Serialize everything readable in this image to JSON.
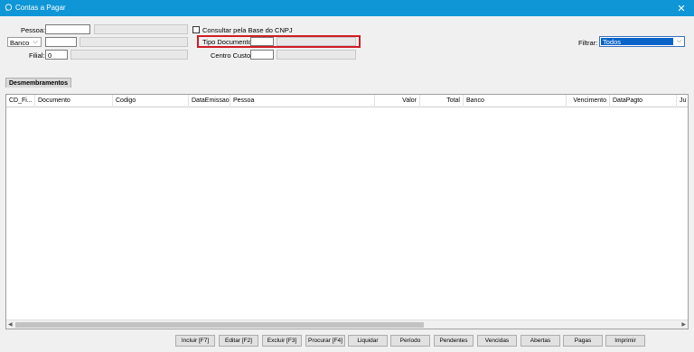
{
  "window": {
    "title": "Contas a Pagar",
    "close_glyph": "✕",
    "icon": "chat-bubble-icon"
  },
  "form": {
    "pessoa_label": "Pessoa:",
    "pessoa_value": "",
    "pessoa_name": "",
    "banco_select": "Banco",
    "banco_value": "",
    "banco_name": "",
    "filial_label": "Filial:",
    "filial_value": "0",
    "filial_name": "",
    "cnpj_checkbox_label": "Consultar pela Base do CNPJ",
    "tipo_documento_label": "Tipo Documento:",
    "tipo_documento_value": "",
    "tipo_documento_name": "",
    "centro_custo_label": "Centro Custo:",
    "centro_custo_value": "",
    "centro_custo_name": "",
    "filtrar_label": "Filtrar:",
    "filtrar_value": "Todos"
  },
  "tab": {
    "label": "Desmembramentos"
  },
  "grid": {
    "columns": [
      "CD_Fi...",
      "Documento",
      "Codigo",
      "DataEmissao",
      "Pessoa",
      "Valor",
      "Total",
      "Banco",
      "Vencimento",
      "DataPagto",
      "Ju"
    ]
  },
  "buttons": {
    "incluir": "Incluir [F7]",
    "editar": "Editar [F2]",
    "excluir": "Excluir [F3]",
    "procurar": "Procurar [F4]",
    "liquidar": "Liquidar",
    "periodo": "Período",
    "pendentes": "Pendentes",
    "vencidas": "Vencidas",
    "abertas": "Abertas",
    "pagas": "Pagas",
    "imprimir": "Imprimir"
  },
  "colors": {
    "titlebar": "#0f96d6",
    "highlight": "#d01c24",
    "selection": "#0a63c9"
  }
}
